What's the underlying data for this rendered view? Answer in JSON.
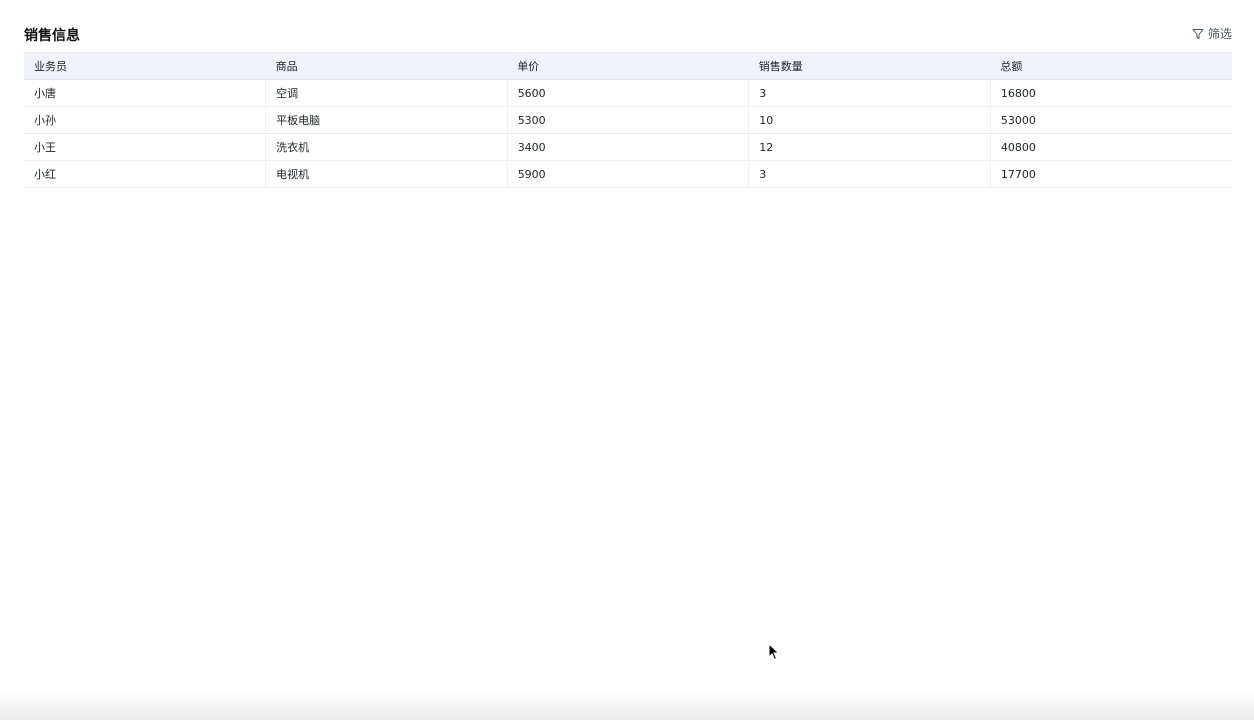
{
  "page": {
    "title": "销售信息",
    "filter_label": "筛选"
  },
  "table": {
    "headers": [
      "业务员",
      "商品",
      "单价",
      "销售数量",
      "总额"
    ],
    "rows": [
      [
        "小唐",
        "空调",
        "5600",
        "3",
        "16800"
      ],
      [
        "小孙",
        "平板电脑",
        "5300",
        "10",
        "53000"
      ],
      [
        "小王",
        "洗衣机",
        "3400",
        "12",
        "40800"
      ],
      [
        "小红",
        "电视机",
        "5900",
        "3",
        "17700"
      ]
    ]
  },
  "icons": {
    "filter": "filter-icon",
    "cursor": "mouse-pointer-icon"
  }
}
